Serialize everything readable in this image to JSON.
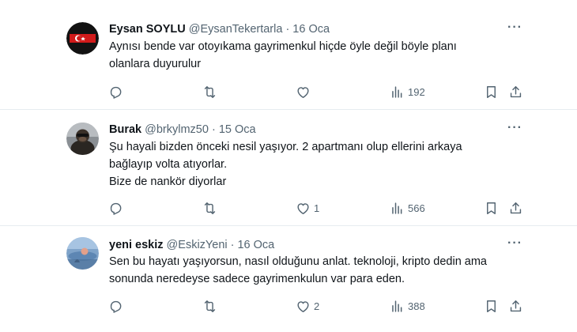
{
  "tweets": [
    {
      "name": "Eysan SOYLU",
      "handle": "@EysanTekertarla",
      "date": "· 16 Oca",
      "lines": [
        "Aynısı bende var otoyıkama gayrimenkul hiçde öyle değil böyle planı",
        "olanlara duyurulur"
      ],
      "likes": "",
      "views": "192"
    },
    {
      "name": "Burak",
      "handle": "@brkylmz50",
      "date": "· 15 Oca",
      "lines": [
        "Şu hayali bizden önceki nesil yaşıyor. 2 apartmanı olup ellerini arkaya",
        "bağlayıp volta atıyorlar.",
        "Bize de nankör diyorlar"
      ],
      "likes": "1",
      "views": "566"
    },
    {
      "name": "yeni eskiz",
      "handle": "@EskizYeni",
      "date": "· 16 Oca",
      "lines": [
        "Sen bu hayatı yaşıyorsun, nasıl olduğunu anlat. teknoloji, kripto dedin ama",
        "sonunda neredeyse sadece gayrimenkulun var para eden."
      ],
      "likes": "2",
      "views": "388"
    }
  ],
  "icons": {
    "more": "more-horizontal-icon",
    "reply": "reply-icon",
    "retweet": "retweet-icon",
    "like": "heart-icon",
    "views": "views-chart-icon",
    "bookmark": "bookmark-icon",
    "share": "share-icon"
  },
  "colors": {
    "text": "#0f1419",
    "secondary": "#536471",
    "divider": "#e6ecf0"
  }
}
